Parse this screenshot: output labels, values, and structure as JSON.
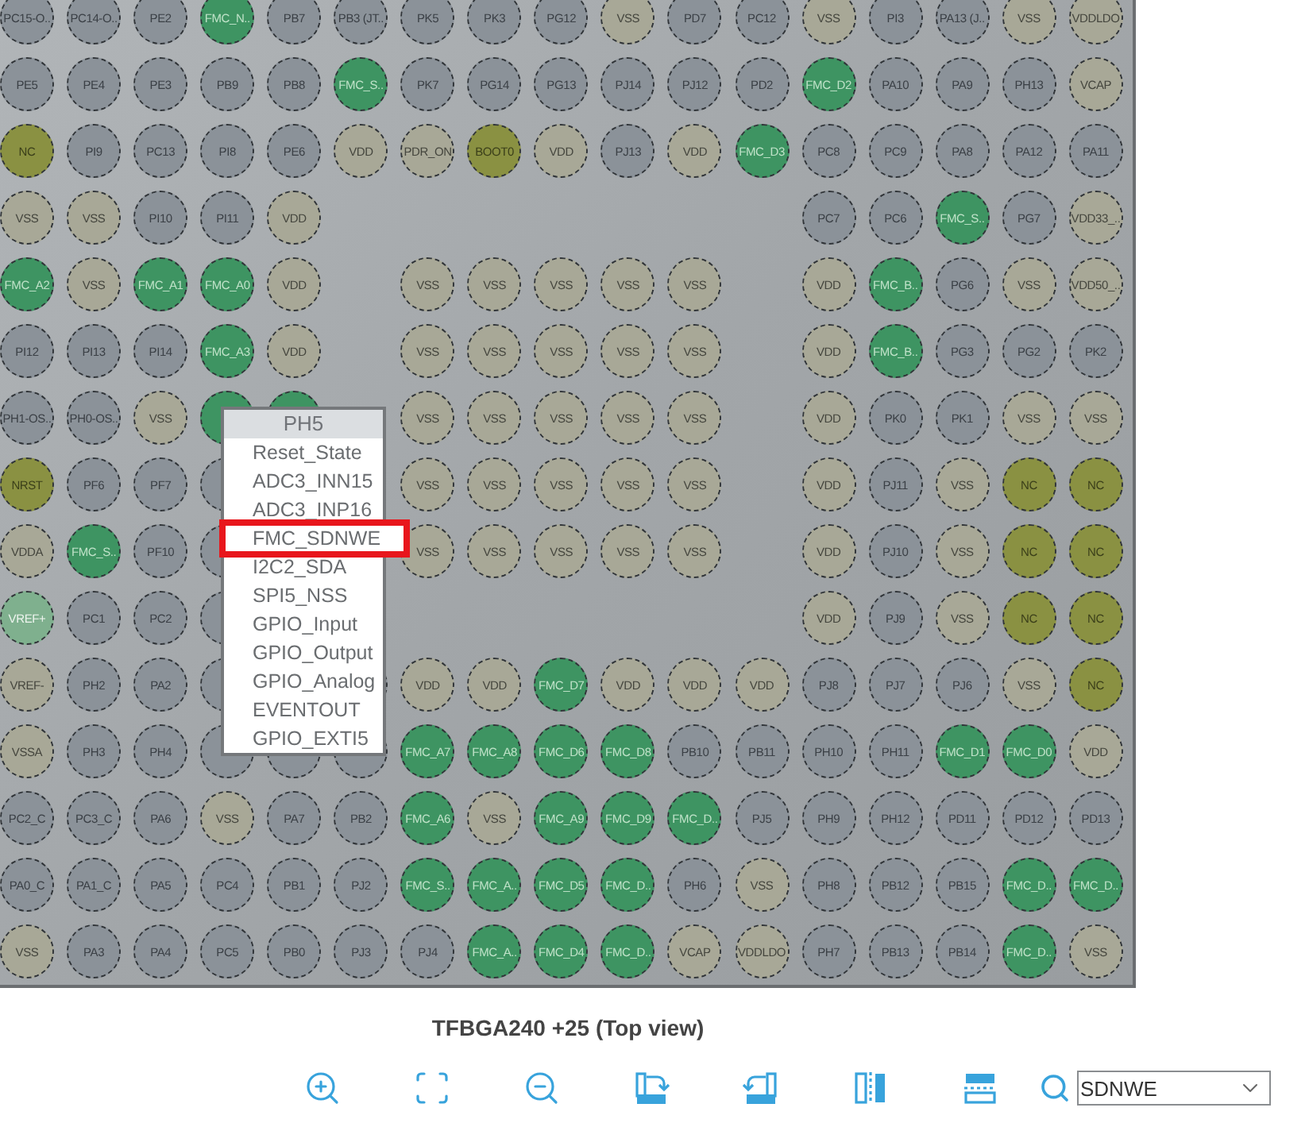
{
  "pin_grid": [
    [
      {
        "label": "PC15-O..",
        "kind": "io"
      },
      {
        "label": "PC14-O..",
        "kind": "io"
      },
      {
        "label": "PE2",
        "kind": "io"
      },
      {
        "label": "FMC_N..",
        "kind": "fmc"
      },
      {
        "label": "PB7",
        "kind": "io"
      },
      {
        "label": "PB3 (JT..",
        "kind": "io"
      },
      {
        "label": "PK5",
        "kind": "io"
      },
      {
        "label": "PK3",
        "kind": "io"
      },
      {
        "label": "PG12",
        "kind": "io"
      },
      {
        "label": "VSS",
        "kind": "power"
      },
      {
        "label": "PD7",
        "kind": "io"
      },
      {
        "label": "PC12",
        "kind": "io"
      },
      {
        "label": "VSS",
        "kind": "power"
      },
      {
        "label": "PI3",
        "kind": "io"
      },
      {
        "label": "PA13 (J..",
        "kind": "io"
      },
      {
        "label": "VSS",
        "kind": "power"
      },
      {
        "label": "VDDLDO",
        "kind": "power"
      }
    ],
    [
      {
        "label": "PE5",
        "kind": "io"
      },
      {
        "label": "PE4",
        "kind": "io"
      },
      {
        "label": "PE3",
        "kind": "io"
      },
      {
        "label": "PB9",
        "kind": "io"
      },
      {
        "label": "PB8",
        "kind": "io"
      },
      {
        "label": "FMC_S..",
        "kind": "fmc"
      },
      {
        "label": "PK7",
        "kind": "io"
      },
      {
        "label": "PG14",
        "kind": "io"
      },
      {
        "label": "PG13",
        "kind": "io"
      },
      {
        "label": "PJ14",
        "kind": "io"
      },
      {
        "label": "PJ12",
        "kind": "io"
      },
      {
        "label": "PD2",
        "kind": "io"
      },
      {
        "label": "FMC_D2",
        "kind": "fmc"
      },
      {
        "label": "PA10",
        "kind": "io"
      },
      {
        "label": "PA9",
        "kind": "io"
      },
      {
        "label": "PH13",
        "kind": "io"
      },
      {
        "label": "VCAP",
        "kind": "power"
      }
    ],
    [
      {
        "label": "NC",
        "kind": "nc"
      },
      {
        "label": "PI9",
        "kind": "io"
      },
      {
        "label": "PC13",
        "kind": "io"
      },
      {
        "label": "PI8",
        "kind": "io"
      },
      {
        "label": "PE6",
        "kind": "io"
      },
      {
        "label": "VDD",
        "kind": "power"
      },
      {
        "label": "PDR_ON",
        "kind": "power"
      },
      {
        "label": "BOOT0",
        "kind": "nc"
      },
      {
        "label": "VDD",
        "kind": "power"
      },
      {
        "label": "PJ13",
        "kind": "io"
      },
      {
        "label": "VDD",
        "kind": "power"
      },
      {
        "label": "FMC_D3",
        "kind": "fmc"
      },
      {
        "label": "PC8",
        "kind": "io"
      },
      {
        "label": "PC9",
        "kind": "io"
      },
      {
        "label": "PA8",
        "kind": "io"
      },
      {
        "label": "PA12",
        "kind": "io"
      },
      {
        "label": "PA11",
        "kind": "io"
      }
    ],
    [
      {
        "label": "VSS",
        "kind": "power"
      },
      {
        "label": "VSS",
        "kind": "power"
      },
      {
        "label": "PI10",
        "kind": "io"
      },
      {
        "label": "PI11",
        "kind": "io"
      },
      {
        "label": "VDD",
        "kind": "power"
      },
      {
        "kind": "empty"
      },
      {
        "kind": "empty"
      },
      {
        "kind": "empty"
      },
      {
        "kind": "empty"
      },
      {
        "kind": "empty"
      },
      {
        "kind": "empty"
      },
      {
        "kind": "empty"
      },
      {
        "label": "PC7",
        "kind": "io"
      },
      {
        "label": "PC6",
        "kind": "io"
      },
      {
        "label": "FMC_S..",
        "kind": "fmc"
      },
      {
        "label": "PG7",
        "kind": "io"
      },
      {
        "label": "VDD33_..",
        "kind": "power"
      }
    ],
    [
      {
        "label": "FMC_A2",
        "kind": "fmc"
      },
      {
        "label": "VSS",
        "kind": "power"
      },
      {
        "label": "FMC_A1",
        "kind": "fmc"
      },
      {
        "label": "FMC_A0",
        "kind": "fmc"
      },
      {
        "label": "VDD",
        "kind": "power"
      },
      {
        "kind": "empty"
      },
      {
        "label": "VSS",
        "kind": "power"
      },
      {
        "label": "VSS",
        "kind": "power"
      },
      {
        "label": "VSS",
        "kind": "power"
      },
      {
        "label": "VSS",
        "kind": "power"
      },
      {
        "label": "VSS",
        "kind": "power"
      },
      {
        "kind": "empty"
      },
      {
        "label": "VDD",
        "kind": "power"
      },
      {
        "label": "FMC_B..",
        "kind": "fmc"
      },
      {
        "label": "PG6",
        "kind": "io"
      },
      {
        "label": "VSS",
        "kind": "power"
      },
      {
        "label": "VDD50_..",
        "kind": "power"
      }
    ],
    [
      {
        "label": "PI12",
        "kind": "io"
      },
      {
        "label": "PI13",
        "kind": "io"
      },
      {
        "label": "PI14",
        "kind": "io"
      },
      {
        "label": "FMC_A3",
        "kind": "fmc"
      },
      {
        "label": "VDD",
        "kind": "power"
      },
      {
        "kind": "empty"
      },
      {
        "label": "VSS",
        "kind": "power"
      },
      {
        "label": "VSS",
        "kind": "power"
      },
      {
        "label": "VSS",
        "kind": "power"
      },
      {
        "label": "VSS",
        "kind": "power"
      },
      {
        "label": "VSS",
        "kind": "power"
      },
      {
        "kind": "empty"
      },
      {
        "label": "VDD",
        "kind": "power"
      },
      {
        "label": "FMC_B..",
        "kind": "fmc"
      },
      {
        "label": "PG3",
        "kind": "io"
      },
      {
        "label": "PG2",
        "kind": "io"
      },
      {
        "label": "PK2",
        "kind": "io"
      }
    ],
    [
      {
        "label": "PH1-OS..",
        "kind": "io"
      },
      {
        "label": "PH0-OS..",
        "kind": "io"
      },
      {
        "label": "VSS",
        "kind": "power"
      },
      {
        "kind": "fmc"
      },
      {
        "kind": "fmc"
      },
      {
        "kind": "empty"
      },
      {
        "label": "VSS",
        "kind": "power"
      },
      {
        "label": "VSS",
        "kind": "power"
      },
      {
        "label": "VSS",
        "kind": "power"
      },
      {
        "label": "VSS",
        "kind": "power"
      },
      {
        "label": "VSS",
        "kind": "power"
      },
      {
        "kind": "empty"
      },
      {
        "label": "VDD",
        "kind": "power"
      },
      {
        "label": "PK0",
        "kind": "io"
      },
      {
        "label": "PK1",
        "kind": "io"
      },
      {
        "label": "VSS",
        "kind": "power"
      },
      {
        "label": "VSS",
        "kind": "power"
      }
    ],
    [
      {
        "label": "NRST",
        "kind": "nc"
      },
      {
        "label": "PF6",
        "kind": "io"
      },
      {
        "label": "PF7",
        "kind": "io"
      },
      {
        "kind": "io"
      },
      {
        "kind": "empty"
      },
      {
        "kind": "empty"
      },
      {
        "label": "VSS",
        "kind": "power"
      },
      {
        "label": "VSS",
        "kind": "power"
      },
      {
        "label": "VSS",
        "kind": "power"
      },
      {
        "label": "VSS",
        "kind": "power"
      },
      {
        "label": "VSS",
        "kind": "power"
      },
      {
        "kind": "empty"
      },
      {
        "label": "VDD",
        "kind": "power"
      },
      {
        "label": "PJ11",
        "kind": "io"
      },
      {
        "label": "VSS",
        "kind": "power"
      },
      {
        "label": "NC",
        "kind": "nc"
      },
      {
        "label": "NC",
        "kind": "nc"
      }
    ],
    [
      {
        "label": "VDDA",
        "kind": "power"
      },
      {
        "label": "FMC_S..",
        "kind": "fmc"
      },
      {
        "label": "PF10",
        "kind": "io"
      },
      {
        "kind": "io"
      },
      {
        "kind": "empty"
      },
      {
        "kind": "empty"
      },
      {
        "label": "VSS",
        "kind": "power"
      },
      {
        "label": "VSS",
        "kind": "power"
      },
      {
        "label": "VSS",
        "kind": "power"
      },
      {
        "label": "VSS",
        "kind": "power"
      },
      {
        "label": "VSS",
        "kind": "power"
      },
      {
        "kind": "empty"
      },
      {
        "label": "VDD",
        "kind": "power"
      },
      {
        "label": "PJ10",
        "kind": "io"
      },
      {
        "label": "VSS",
        "kind": "power"
      },
      {
        "label": "NC",
        "kind": "nc"
      },
      {
        "label": "NC",
        "kind": "nc"
      }
    ],
    [
      {
        "label": "VREF+",
        "kind": "vref"
      },
      {
        "label": "PC1",
        "kind": "io"
      },
      {
        "label": "PC2",
        "kind": "io"
      },
      {
        "kind": "io"
      },
      {
        "kind": "empty"
      },
      {
        "kind": "empty"
      },
      {
        "kind": "empty"
      },
      {
        "kind": "empty"
      },
      {
        "kind": "empty"
      },
      {
        "kind": "empty"
      },
      {
        "kind": "empty"
      },
      {
        "kind": "empty"
      },
      {
        "label": "VDD",
        "kind": "power"
      },
      {
        "label": "PJ9",
        "kind": "io"
      },
      {
        "label": "VSS",
        "kind": "power"
      },
      {
        "label": "NC",
        "kind": "nc"
      },
      {
        "label": "NC",
        "kind": "nc"
      }
    ],
    [
      {
        "label": "VREF-",
        "kind": "power"
      },
      {
        "label": "PH2",
        "kind": "io"
      },
      {
        "label": "PA2",
        "kind": "io"
      },
      {
        "kind": "io"
      },
      {
        "kind": "empty"
      },
      {
        "kind": "io"
      },
      {
        "label": "VDD",
        "kind": "power"
      },
      {
        "label": "VDD",
        "kind": "power"
      },
      {
        "label": "FMC_D7",
        "kind": "fmc"
      },
      {
        "label": "VDD",
        "kind": "power"
      },
      {
        "label": "VDD",
        "kind": "power"
      },
      {
        "label": "VDD",
        "kind": "power"
      },
      {
        "label": "PJ8",
        "kind": "io"
      },
      {
        "label": "PJ7",
        "kind": "io"
      },
      {
        "label": "PJ6",
        "kind": "io"
      },
      {
        "label": "VSS",
        "kind": "power"
      },
      {
        "label": "NC",
        "kind": "nc"
      }
    ],
    [
      {
        "label": "VSSA",
        "kind": "power"
      },
      {
        "label": "PH3",
        "kind": "io"
      },
      {
        "label": "PH4",
        "kind": "io"
      },
      {
        "kind": "io"
      },
      {
        "kind": "io"
      },
      {
        "kind": "io"
      },
      {
        "label": "FMC_A7",
        "kind": "fmc"
      },
      {
        "label": "FMC_A8",
        "kind": "fmc"
      },
      {
        "label": "FMC_D6",
        "kind": "fmc"
      },
      {
        "label": "FMC_D8",
        "kind": "fmc"
      },
      {
        "label": "PB10",
        "kind": "io"
      },
      {
        "label": "PB11",
        "kind": "io"
      },
      {
        "label": "PH10",
        "kind": "io"
      },
      {
        "label": "PH11",
        "kind": "io"
      },
      {
        "label": "FMC_D1",
        "kind": "fmc"
      },
      {
        "label": "FMC_D0",
        "kind": "fmc"
      },
      {
        "label": "VDD",
        "kind": "power"
      }
    ],
    [
      {
        "label": "PC2_C",
        "kind": "io"
      },
      {
        "label": "PC3_C",
        "kind": "io"
      },
      {
        "label": "PA6",
        "kind": "io"
      },
      {
        "label": "VSS",
        "kind": "power"
      },
      {
        "label": "PA7",
        "kind": "io"
      },
      {
        "label": "PB2",
        "kind": "io"
      },
      {
        "label": "FMC_A6",
        "kind": "fmc"
      },
      {
        "label": "VSS",
        "kind": "power"
      },
      {
        "label": "FMC_A9",
        "kind": "fmc"
      },
      {
        "label": "FMC_D9",
        "kind": "fmc"
      },
      {
        "label": "FMC_D..",
        "kind": "fmc"
      },
      {
        "label": "PJ5",
        "kind": "io"
      },
      {
        "label": "PH9",
        "kind": "io"
      },
      {
        "label": "PH12",
        "kind": "io"
      },
      {
        "label": "PD11",
        "kind": "io"
      },
      {
        "label": "PD12",
        "kind": "io"
      },
      {
        "label": "PD13",
        "kind": "io"
      }
    ],
    [
      {
        "label": "PA0_C",
        "kind": "io"
      },
      {
        "label": "PA1_C",
        "kind": "io"
      },
      {
        "label": "PA5",
        "kind": "io"
      },
      {
        "label": "PC4",
        "kind": "io"
      },
      {
        "label": "PB1",
        "kind": "io"
      },
      {
        "label": "PJ2",
        "kind": "io"
      },
      {
        "label": "FMC_S..",
        "kind": "fmc"
      },
      {
        "label": "FMC_A..",
        "kind": "fmc"
      },
      {
        "label": "FMC_D5",
        "kind": "fmc"
      },
      {
        "label": "FMC_D..",
        "kind": "fmc"
      },
      {
        "label": "PH6",
        "kind": "io"
      },
      {
        "label": "VSS",
        "kind": "power"
      },
      {
        "label": "PH8",
        "kind": "io"
      },
      {
        "label": "PB12",
        "kind": "io"
      },
      {
        "label": "PB15",
        "kind": "io"
      },
      {
        "label": "FMC_D..",
        "kind": "fmc"
      },
      {
        "label": "FMC_D..",
        "kind": "fmc"
      }
    ],
    [
      {
        "label": "VSS",
        "kind": "power"
      },
      {
        "label": "PA3",
        "kind": "io"
      },
      {
        "label": "PA4",
        "kind": "io"
      },
      {
        "label": "PC5",
        "kind": "io"
      },
      {
        "label": "PB0",
        "kind": "io"
      },
      {
        "label": "PJ3",
        "kind": "io"
      },
      {
        "label": "PJ4",
        "kind": "io"
      },
      {
        "label": "FMC_A..",
        "kind": "fmc"
      },
      {
        "label": "FMC_D4",
        "kind": "fmc"
      },
      {
        "label": "FMC_D..",
        "kind": "fmc"
      },
      {
        "label": "VCAP",
        "kind": "power"
      },
      {
        "label": "VDDLDO",
        "kind": "power"
      },
      {
        "label": "PH7",
        "kind": "io"
      },
      {
        "label": "PB13",
        "kind": "io"
      },
      {
        "label": "PB14",
        "kind": "io"
      },
      {
        "label": "FMC_D..",
        "kind": "fmc"
      },
      {
        "label": "VSS",
        "kind": "power"
      }
    ]
  ],
  "pin_menu": {
    "title": "PH5",
    "items": [
      {
        "label": "Reset_State",
        "selected": false
      },
      {
        "label": "ADC3_INN15",
        "selected": false
      },
      {
        "label": "ADC3_INP16",
        "selected": false
      },
      {
        "label": "FMC_SDNWE",
        "selected": true
      },
      {
        "label": "I2C2_SDA",
        "selected": false
      },
      {
        "label": "SPI5_NSS",
        "selected": false
      },
      {
        "label": "GPIO_Input",
        "selected": false
      },
      {
        "label": "GPIO_Output",
        "selected": false
      },
      {
        "label": "GPIO_Analog",
        "selected": false
      },
      {
        "label": "EVENTOUT",
        "selected": false
      },
      {
        "label": "GPIO_EXTI5",
        "selected": false
      }
    ]
  },
  "package_title": "TFBGA240 +25 (Top view)",
  "search": {
    "value": "SDNWE"
  }
}
